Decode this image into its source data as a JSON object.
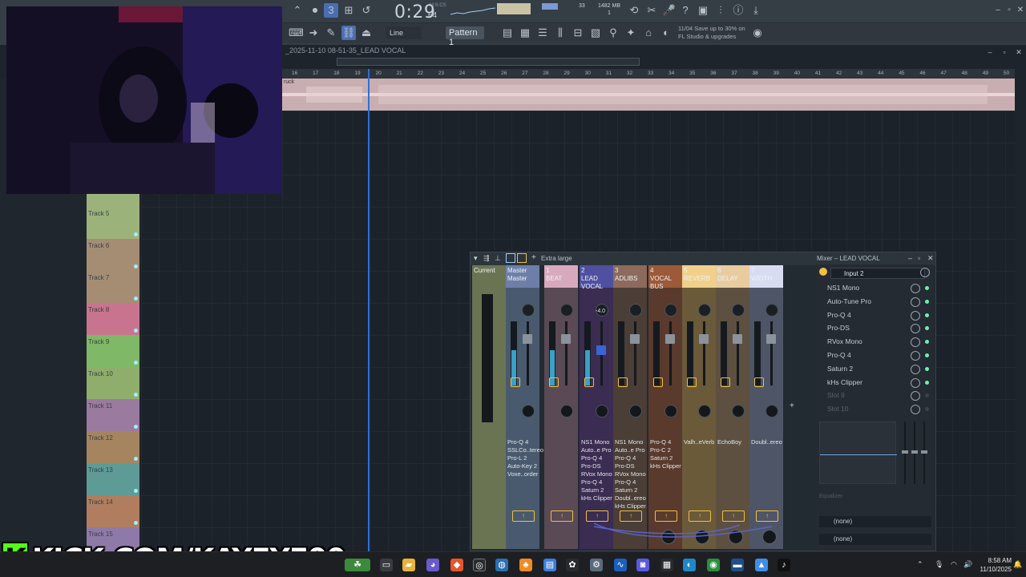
{
  "toolbar": {
    "time": "0:29",
    "time_small": "64",
    "time_units": "M:S:CS",
    "cpu_value": "33",
    "mem_value": "1482 MB",
    "voices": "1",
    "pattern": "Pattern 1",
    "snap": "Line",
    "news_line1": "11/04  Save up to 30% on",
    "news_line2": "FL Studio & upgrades"
  },
  "playlist": {
    "title": "_2025-11-10 08-51-35_LEAD VOCAL",
    "audio_label": "ruck",
    "ruler": [
      "16",
      "17",
      "18",
      "19",
      "20",
      "21",
      "22",
      "23",
      "24",
      "25",
      "26",
      "27",
      "28",
      "29",
      "30",
      "31",
      "32",
      "33",
      "34",
      "35",
      "36",
      "37",
      "38",
      "39",
      "40",
      "41",
      "42",
      "43",
      "44",
      "45",
      "46",
      "47",
      "48",
      "49",
      "50"
    ],
    "tracks": [
      "Track 5",
      "Track 6",
      "Track 7",
      "Track 8",
      "Track 9",
      "Track 10",
      "Track 11",
      "Track 12",
      "Track 13",
      "Track 14",
      "Track 15"
    ]
  },
  "mixer": {
    "size_label": "Extra large",
    "title": "Mixer – LEAD VOCAL",
    "strips": [
      {
        "num": "",
        "name": "Current",
        "plugins": []
      },
      {
        "num": "",
        "name": "Master",
        "sub": "Master",
        "plugins": [
          "Pro-Q 4",
          "SSLCo..tereo",
          "Pro-L 2",
          "Auto-Key 2",
          "Voxe..order"
        ]
      },
      {
        "num": "1",
        "name": "BEAT",
        "plugins": []
      },
      {
        "num": "2",
        "name": "LEAD VOCAL",
        "level": "-4.0",
        "plugins": [
          "NS1 Mono",
          "Auto..e Pro",
          "Pro-Q 4",
          "Pro-DS",
          "RVox Mono",
          "Pro-Q 4",
          "Saturn 2",
          "kHs Clipper"
        ]
      },
      {
        "num": "3",
        "name": "ADLIBS",
        "plugins": [
          "NS1 Mono",
          "Auto..e Pro",
          "Pro-Q 4",
          "Pro-DS",
          "RVox Mono",
          "Pro-Q 4",
          "Saturn 2",
          "Doubl..ereo",
          "kHs Clipper"
        ]
      },
      {
        "num": "4",
        "name": "VOCAL BUS",
        "plugins": [
          "Pro-Q 4",
          "Pro-C 2",
          "Saturn 2",
          "kHs Clipper"
        ]
      },
      {
        "num": "5",
        "name": "REVERB",
        "plugins": [
          "Valh..eVerb"
        ]
      },
      {
        "num": "6",
        "name": "DELAY",
        "plugins": [
          "EchoBoy"
        ]
      },
      {
        "num": "7",
        "name": "WIDTH",
        "plugins": [
          "Doubl..ereo"
        ]
      }
    ],
    "insert": {
      "input": "Input 2",
      "slots": [
        "NS1 Mono",
        "Auto-Tune Pro",
        "Pro-Q 4",
        "Pro-DS",
        "RVox Mono",
        "Pro-Q 4",
        "Saturn 2",
        "kHs Clipper",
        "Slot 9",
        "Slot 10"
      ],
      "equalizer_label": "Equalizer",
      "out1": "(none)",
      "out2": "(none)"
    }
  },
  "overlay": {
    "kick_k": "K",
    "kick_text": "KICK.COM/KAYEYE00"
  },
  "taskbar": {
    "time": "8:58 AM",
    "date": "11/10/2025"
  },
  "colors": {
    "accent": "#f0c040",
    "playhead": "#2e6fd8",
    "kick_green": "#53fc18"
  }
}
